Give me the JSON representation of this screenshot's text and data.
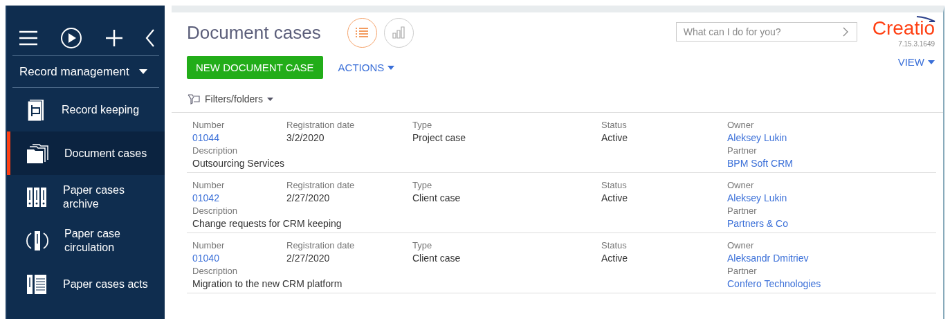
{
  "sidebar": {
    "section": "Record management",
    "items": [
      {
        "label": "Record keeping",
        "kind": "book",
        "selected": false
      },
      {
        "label": "Document cases",
        "kind": "folders",
        "selected": true
      },
      {
        "label": "Paper cases archive",
        "kind": "archive",
        "selected": false
      },
      {
        "label": "Paper case circulation",
        "kind": "circulation",
        "selected": false
      },
      {
        "label": "Paper cases acts",
        "kind": "acts",
        "selected": false
      }
    ]
  },
  "header": {
    "title": "Document cases",
    "views": [
      {
        "kind": "list",
        "selected": true
      },
      {
        "kind": "chart",
        "selected": false
      }
    ],
    "search": {
      "placeholder": "What can I do for you?"
    },
    "logo": "Creatio",
    "version": "7.15.3.1649"
  },
  "toolbar": {
    "primary": "NEW DOCUMENT CASE",
    "actions": "ACTIONS",
    "view": "VIEW",
    "filters": "Filters/folders"
  },
  "records": [
    {
      "fields": [
        {
          "label": "Number",
          "value": "01044",
          "kind": "link"
        },
        {
          "label": "Registration date",
          "value": "3/2/2020",
          "kind": "text"
        },
        {
          "label": "Type",
          "value": "Project case",
          "kind": "text"
        },
        {
          "label": "Status",
          "value": "Active",
          "kind": "text"
        },
        {
          "label": "Owner",
          "value": "Aleksey Lukin",
          "kind": "link"
        },
        {
          "label": "Description",
          "value": "Outsourcing Services",
          "kind": "text"
        },
        {
          "label": "Partner",
          "value": "BPM Soft CRM",
          "kind": "link"
        }
      ]
    },
    {
      "fields": [
        {
          "label": "Number",
          "value": "01042",
          "kind": "link"
        },
        {
          "label": "Registration date",
          "value": "2/27/2020",
          "kind": "text"
        },
        {
          "label": "Type",
          "value": "Client case",
          "kind": "text"
        },
        {
          "label": "Status",
          "value": "Active",
          "kind": "text"
        },
        {
          "label": "Owner",
          "value": "Aleksey Lukin",
          "kind": "link"
        },
        {
          "label": "Description",
          "value": "Change requests for CRM keeping",
          "kind": "text"
        },
        {
          "label": "Partner",
          "value": "Partners & Co",
          "kind": "link"
        }
      ]
    },
    {
      "fields": [
        {
          "label": "Number",
          "value": "01040",
          "kind": "link"
        },
        {
          "label": "Registration date",
          "value": "2/27/2020",
          "kind": "text"
        },
        {
          "label": "Type",
          "value": "Client case",
          "kind": "text"
        },
        {
          "label": "Status",
          "value": "Active",
          "kind": "text"
        },
        {
          "label": "Owner",
          "value": "Aleksandr Dmitriev",
          "kind": "link"
        },
        {
          "label": "Description",
          "value": "Migration to the new CRM platform",
          "kind": "text"
        },
        {
          "label": "Partner",
          "value": "Confero Technologies",
          "kind": "link"
        }
      ]
    }
  ]
}
